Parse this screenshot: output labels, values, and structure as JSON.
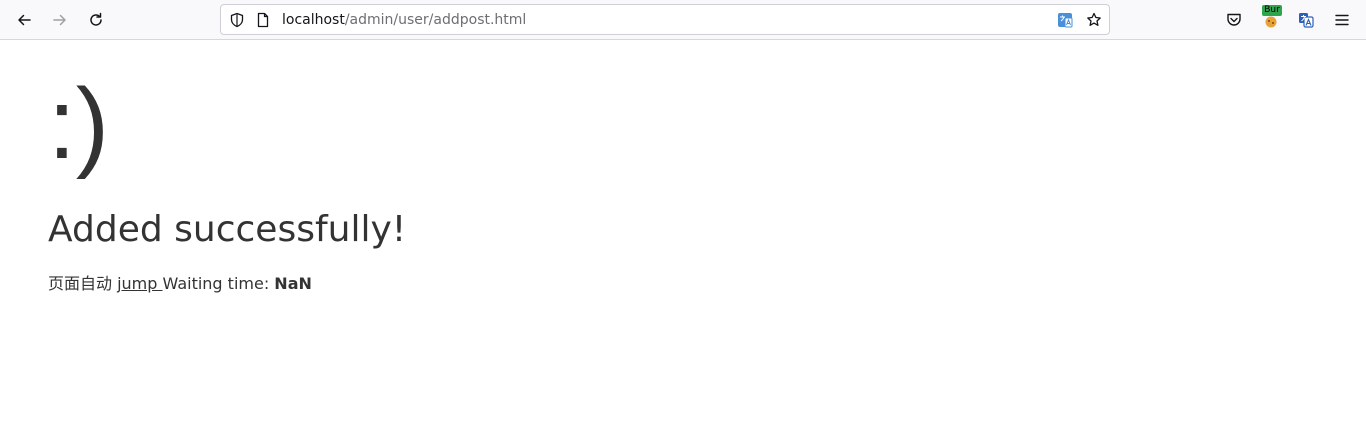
{
  "browser": {
    "url_host": "localhost",
    "url_path": "/admin/user/addpost.html",
    "icons": {
      "back": "back-arrow-icon",
      "forward": "forward-arrow-icon",
      "reload": "reload-icon",
      "shield": "tracking-shield-icon",
      "page": "page-info-icon",
      "translate": "translate-icon",
      "bookmark": "bookmark-star-icon",
      "pocket": "pocket-icon",
      "burp": "burp-extension-icon",
      "translate_ext": "translate-extension-icon",
      "menu": "hamburger-menu-icon"
    },
    "burp_badge": "Bur"
  },
  "page": {
    "face": ":)",
    "title": "Added successfully!",
    "jump_prefix": "页面自动 ",
    "jump_link": "jump ",
    "wait_label": "Waiting time: ",
    "wait_value": "NaN"
  }
}
